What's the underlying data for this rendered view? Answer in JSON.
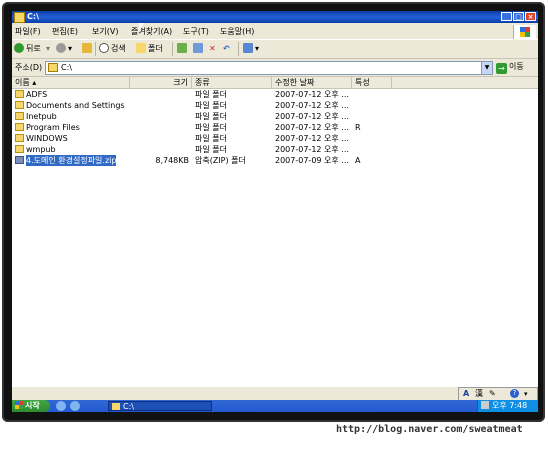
{
  "window": {
    "title": "C:\\",
    "buttons": [
      "_",
      "□",
      "×"
    ]
  },
  "menu": [
    "파일(F)",
    "편집(E)",
    "보기(V)",
    "즐겨찾기(A)",
    "도구(T)",
    "도움말(H)"
  ],
  "toolbar": {
    "back_label": "뒤로",
    "search_label": "검색",
    "folders_label": "폴더"
  },
  "address": {
    "label": "주소(D)",
    "value": "C:\\",
    "go_label": "이동"
  },
  "columns": [
    "이름",
    "크기",
    "종류",
    "수정한 날짜",
    "특성"
  ],
  "files": [
    {
      "name": "ADFS",
      "size": "",
      "type": "파일 폴더",
      "modified": "2007-07-12 오후 ...",
      "attr": "",
      "kind": "folder"
    },
    {
      "name": "Documents and Settings",
      "size": "",
      "type": "파일 폴더",
      "modified": "2007-07-12 오후 ...",
      "attr": "",
      "kind": "folder"
    },
    {
      "name": "Inetpub",
      "size": "",
      "type": "파일 폴더",
      "modified": "2007-07-12 오후 ...",
      "attr": "",
      "kind": "folder"
    },
    {
      "name": "Program Files",
      "size": "",
      "type": "파일 폴더",
      "modified": "2007-07-12 오후 ...",
      "attr": "R",
      "kind": "folder"
    },
    {
      "name": "WINDOWS",
      "size": "",
      "type": "파일 폴더",
      "modified": "2007-07-12 오후 ...",
      "attr": "",
      "kind": "folder"
    },
    {
      "name": "wmpub",
      "size": "",
      "type": "파일 폴더",
      "modified": "2007-07-12 오후 ...",
      "attr": "",
      "kind": "folder"
    },
    {
      "name": "4.도메인 환경설정파일.zip",
      "size": "8,748KB",
      "type": "압축(ZIP) 폴더",
      "modified": "2007-07-09 오후 ...",
      "attr": "A",
      "kind": "zip",
      "selected": true
    }
  ],
  "langbar": {
    "a": "A",
    "han": "漢",
    "help": "?"
  },
  "taskbar": {
    "start_label": "시작",
    "task_label": "C:\\",
    "clock": "오후 7:48"
  },
  "watermark": "http://blog.naver.com/sweatmeat"
}
